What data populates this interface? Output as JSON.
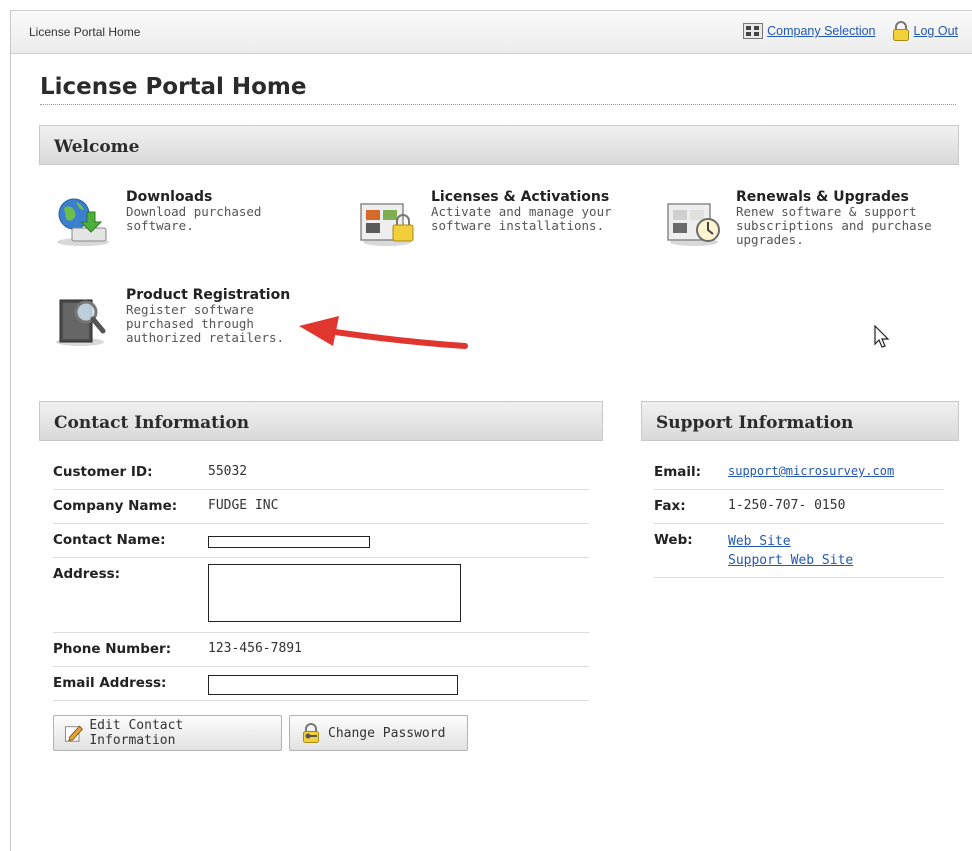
{
  "header": {
    "breadcrumb": "License Portal Home",
    "company_selection": "Company Selection",
    "log_out": "Log Out"
  },
  "page_title": "License Portal Home",
  "welcome": {
    "heading": "Welcome",
    "tiles": [
      {
        "title": "Downloads",
        "desc_lines": [
          "Download purchased",
          "software."
        ],
        "icon": "globe-download-icon"
      },
      {
        "title": "Licenses & Activations",
        "desc_lines": [
          "Activate and manage your",
          "software installations."
        ],
        "icon": "license-lock-icon"
      },
      {
        "title": "Renewals & Upgrades",
        "desc_lines": [
          "Renew software & support",
          "subscriptions and purchase",
          "upgrades."
        ],
        "icon": "license-clock-icon"
      },
      {
        "title": "Product Registration",
        "desc_lines": [
          "Register software",
          "purchased through",
          "authorized retailers."
        ],
        "icon": "magnifier-registration-icon"
      }
    ]
  },
  "contact": {
    "heading": "Contact Information",
    "customer_id_label": "Customer ID:",
    "customer_id": "55032",
    "company_label": "Company Name:",
    "company": "FUDGE INC",
    "contact_label": "Contact Name:",
    "address_label": "Address:",
    "phone_label": "Phone Number:",
    "phone": "123-456-7891",
    "email_label": "Email Address:",
    "edit_button": "Edit Contact Information",
    "password_button": "Change Password"
  },
  "support": {
    "heading": "Support Information",
    "email_label": "Email:",
    "email": "support@microsurvey.com",
    "fax_label": "Fax:",
    "fax": "1-250-707- 0150",
    "web_label": "Web:",
    "web_site": "Web Site",
    "support_web_site": "Support Web Site"
  },
  "colors": {
    "link": "#2459b0",
    "arrow": "#e0362f",
    "section_header": "#e2e2e2"
  }
}
